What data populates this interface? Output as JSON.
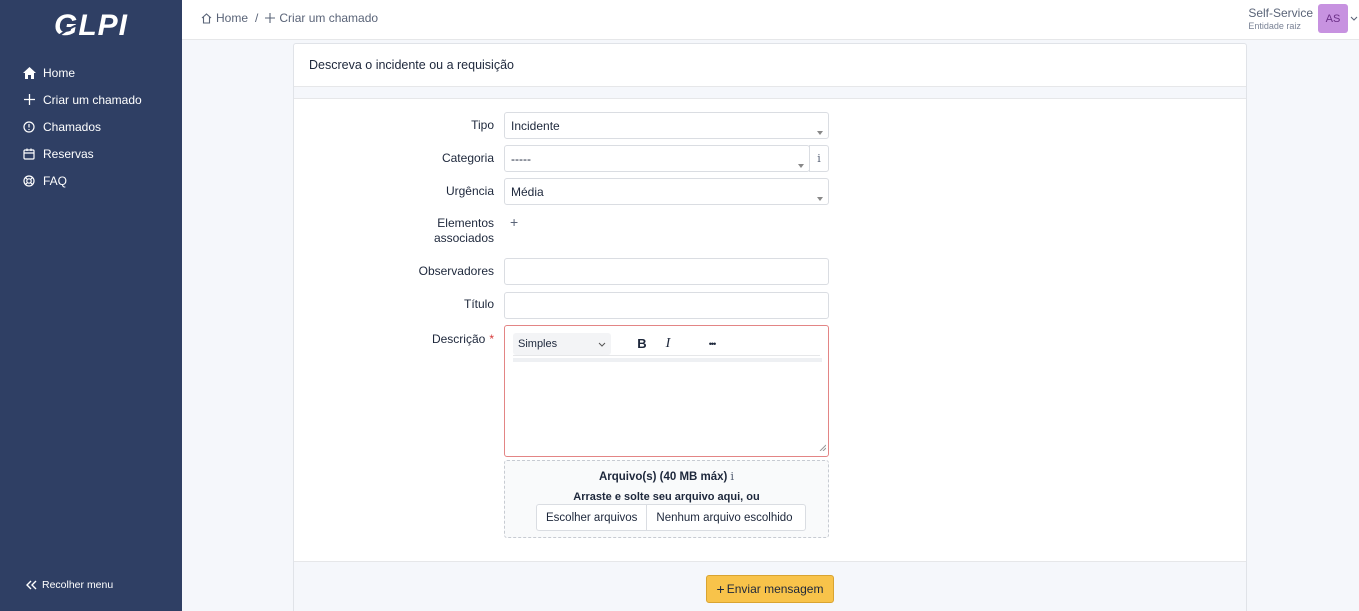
{
  "app": {
    "logo_text": "GLPI"
  },
  "sidebar": {
    "items": [
      {
        "label": "Home",
        "icon": "home-icon"
      },
      {
        "label": "Criar um chamado",
        "icon": "plus-icon"
      },
      {
        "label": "Chamados",
        "icon": "alert-circle-icon"
      },
      {
        "label": "Reservas",
        "icon": "calendar-icon"
      },
      {
        "label": "FAQ",
        "icon": "lifebuoy-icon"
      }
    ],
    "collapse_label": "Recolher menu"
  },
  "header": {
    "breadcrumb": [
      {
        "label": "Home",
        "icon": "home-icon"
      },
      {
        "label": "Criar um chamado",
        "icon": "plus-icon"
      }
    ],
    "breadcrumb_sep": "/",
    "profile": {
      "name": "Self-Service",
      "entity": "Entidade raiz",
      "initials": "AS",
      "avatar_color": "#c792e0"
    }
  },
  "form": {
    "title": "Descreva o incidente ou a requisição",
    "fields": {
      "tipo": {
        "label": "Tipo",
        "value": "Incidente"
      },
      "categoria": {
        "label": "Categoria",
        "value": "-----",
        "info": "i"
      },
      "urgencia": {
        "label": "Urgência",
        "value": "Média"
      },
      "elementos": {
        "label_line1": "Elementos",
        "label_line2": "associados",
        "add": "+"
      },
      "observadores": {
        "label": "Observadores",
        "value": ""
      },
      "titulo": {
        "label": "Título",
        "value": ""
      },
      "descricao": {
        "label": "Descrição",
        "required_mark": "*",
        "format": "Simples",
        "bold": "B",
        "italic": "I",
        "more": "•••"
      }
    },
    "upload": {
      "title": "Arquivo(s) (40 MB máx)",
      "info": "i",
      "drop_text": "Arraste e solte seu arquivo aqui, ou",
      "choose_button": "Escolher arquivos",
      "no_file": "Nenhum arquivo escolhido"
    },
    "submit_label": "Enviar mensagem",
    "submit_color": "#f8c34a"
  },
  "colors": {
    "sidebar": "#2f3f64",
    "required_border": "#e38585"
  }
}
